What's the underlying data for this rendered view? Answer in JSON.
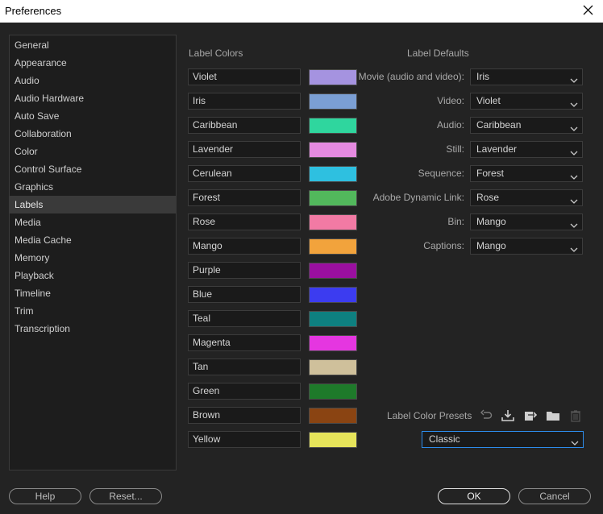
{
  "window": {
    "title": "Preferences"
  },
  "sidebar": {
    "items": [
      "General",
      "Appearance",
      "Audio",
      "Audio Hardware",
      "Auto Save",
      "Collaboration",
      "Color",
      "Control Surface",
      "Graphics",
      "Labels",
      "Media",
      "Media Cache",
      "Memory",
      "Playback",
      "Timeline",
      "Trim",
      "Transcription"
    ],
    "active": "Labels"
  },
  "label_colors": {
    "title": "Label Colors",
    "items": [
      {
        "name": "Violet",
        "color": "#a593e0"
      },
      {
        "name": "Iris",
        "color": "#7b9fd4"
      },
      {
        "name": "Caribbean",
        "color": "#2fd69e"
      },
      {
        "name": "Lavender",
        "color": "#e58ae0"
      },
      {
        "name": "Cerulean",
        "color": "#2ec0e0"
      },
      {
        "name": "Forest",
        "color": "#52b85c"
      },
      {
        "name": "Rose",
        "color": "#f27aa4"
      },
      {
        "name": "Mango",
        "color": "#f2a33c"
      },
      {
        "name": "Purple",
        "color": "#9a0fa0"
      },
      {
        "name": "Blue",
        "color": "#3c3cf0"
      },
      {
        "name": "Teal",
        "color": "#0e8080"
      },
      {
        "name": "Magenta",
        "color": "#e536e0"
      },
      {
        "name": "Tan",
        "color": "#cfc09b"
      },
      {
        "name": "Green",
        "color": "#1e7a2a"
      },
      {
        "name": "Brown",
        "color": "#8a4412"
      },
      {
        "name": "Yellow",
        "color": "#e6e45a"
      }
    ]
  },
  "label_defaults": {
    "title": "Label Defaults",
    "items": [
      {
        "label": "Movie (audio and video):",
        "value": "Iris"
      },
      {
        "label": "Video:",
        "value": "Violet"
      },
      {
        "label": "Audio:",
        "value": "Caribbean"
      },
      {
        "label": "Still:",
        "value": "Lavender"
      },
      {
        "label": "Sequence:",
        "value": "Forest"
      },
      {
        "label": "Adobe Dynamic Link:",
        "value": "Rose"
      },
      {
        "label": "Bin:",
        "value": "Mango"
      },
      {
        "label": "Captions:",
        "value": "Mango"
      }
    ]
  },
  "presets": {
    "label": "Label Color Presets",
    "selected": "Classic",
    "icons": [
      "undo-icon",
      "import-icon",
      "export-icon",
      "folder-icon",
      "trash-icon"
    ]
  },
  "buttons": {
    "help": "Help",
    "reset": "Reset...",
    "ok": "OK",
    "cancel": "Cancel"
  }
}
